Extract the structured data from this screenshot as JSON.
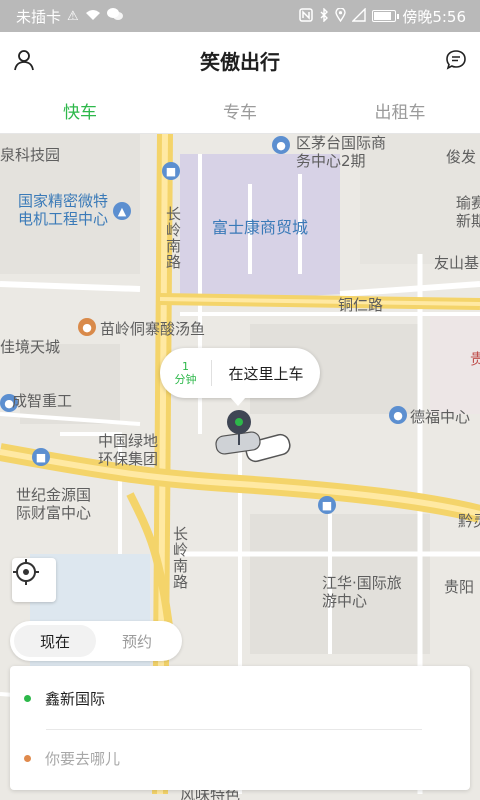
{
  "status_bar": {
    "carrier": "未插卡",
    "time_label": "傍晚5:56",
    "battery_level": 0.75
  },
  "header": {
    "title": "笑傲出行",
    "left_icon": "user-icon",
    "right_icon": "message-icon"
  },
  "tabs": [
    {
      "label": "快车",
      "active": true
    },
    {
      "label": "专车",
      "active": false
    },
    {
      "label": "出租车",
      "active": false
    }
  ],
  "map": {
    "labels": {
      "tech_park": "泉科技园",
      "zhuhai_md": "区茅台国际商\n务中心2期",
      "junfa": "俊发",
      "precision_motor_1": "国家精密微特",
      "precision_motor_2": "电机工程中心",
      "changling_n": "长岭南路",
      "fushikang": "富士康商贸城",
      "yusai_1": "瑜赛",
      "yusai_2": "新期",
      "youshan": "友山基",
      "tongren_road": "铜仁路",
      "miaoling": "苗岭侗寨酸汤鱼",
      "guijing": "佳境天城",
      "gui": "贵",
      "chengzhi": "成智重工",
      "defu": "德福中心",
      "lvdi_1": "中国绿地",
      "lvdi_2": "环保集团",
      "shiji_1": "世纪金源国",
      "shiji_2": "际财富中心",
      "qian": "黔灵",
      "changling_s": "长岭南路",
      "jianghua_1": "江华·国际旅",
      "jianghua_2": "游中心",
      "guiyang": "贵阳",
      "bottom_text": "风味特色"
    }
  },
  "pickup_callout": {
    "eta_value": "1",
    "eta_unit": "分钟",
    "text": "在这里上车"
  },
  "time_toggle": [
    {
      "label": "现在",
      "active": true
    },
    {
      "label": "预约",
      "active": false
    }
  ],
  "address": {
    "from": "鑫新国际",
    "to_placeholder": "你要去哪儿"
  },
  "colors": {
    "accent": "#2db84a",
    "destination_dot": "#e08a4c",
    "status_bar": "#b9b9b9"
  }
}
